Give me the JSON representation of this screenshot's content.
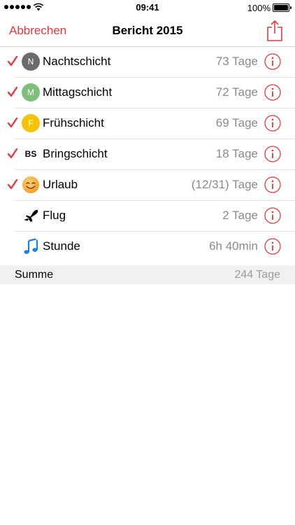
{
  "status_bar": {
    "time": "09:41",
    "battery": "100%"
  },
  "nav": {
    "cancel_label": "Abbrechen",
    "title": "Bericht 2015",
    "share_icon": "share-icon"
  },
  "colors": {
    "accent_red": "#e0393e",
    "value_gray": "#8a8a8f"
  },
  "items": [
    {
      "checked": true,
      "icon": "N",
      "icon_type": "circle",
      "icon_color": "#6b6b6b",
      "label": "Nachtschicht",
      "value": "73 Tage"
    },
    {
      "checked": true,
      "icon": "M",
      "icon_type": "circle",
      "icon_color": "#7cbf7c",
      "label": "Mittagschicht",
      "value": "72 Tage"
    },
    {
      "checked": true,
      "icon": "F",
      "icon_type": "circle",
      "icon_color": "#f5c400",
      "label": "Frühschicht",
      "value": "69 Tage"
    },
    {
      "checked": true,
      "icon": "BS",
      "icon_type": "text",
      "label": "Bringschicht",
      "value": "18 Tage"
    },
    {
      "checked": true,
      "icon": "smiley-emoji",
      "icon_type": "emoji",
      "label": "Urlaub",
      "value": "(12/31) Tage"
    },
    {
      "checked": false,
      "icon": "airplane-icon",
      "icon_type": "glyph",
      "label": "Flug",
      "value": "2 Tage"
    },
    {
      "checked": false,
      "icon": "music-note-icon",
      "icon_type": "glyph",
      "label": "Stunde",
      "value": "6h 40min"
    }
  ],
  "summary": {
    "label": "Summe",
    "value": "244 Tage"
  }
}
